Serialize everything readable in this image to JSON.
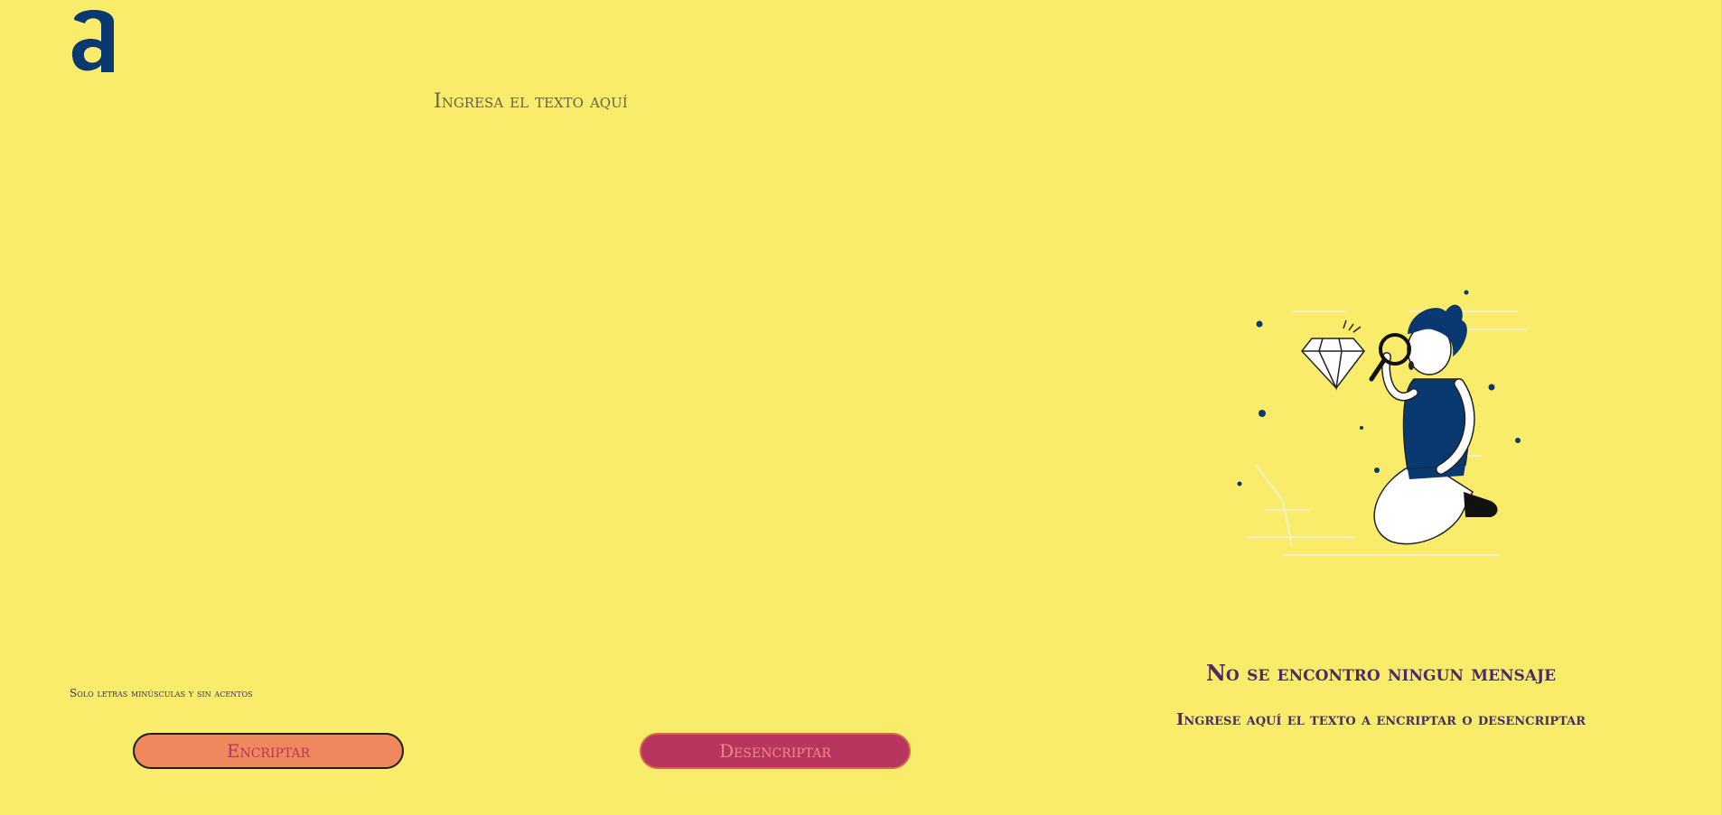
{
  "app": {
    "logo_name": "alura-logo"
  },
  "editor": {
    "placeholder": "Ingresa el texto aquí"
  },
  "hint": {
    "text": "Solo letras minúsculas y sin acentos"
  },
  "buttons": {
    "encrypt_label": "Encriptar",
    "decrypt_label": "Desencriptar"
  },
  "output": {
    "empty_title": "No se encontro ningun mensaje",
    "empty_subtitle": "Ingrese aquí el texto a encriptar o desencriptar"
  },
  "colors": {
    "background": "#f9ec6b",
    "logo": "#0a3871",
    "encrypt_button": "#f0885e",
    "decrypt_button": "#b8355e",
    "text_dark": "#4b2c66"
  }
}
